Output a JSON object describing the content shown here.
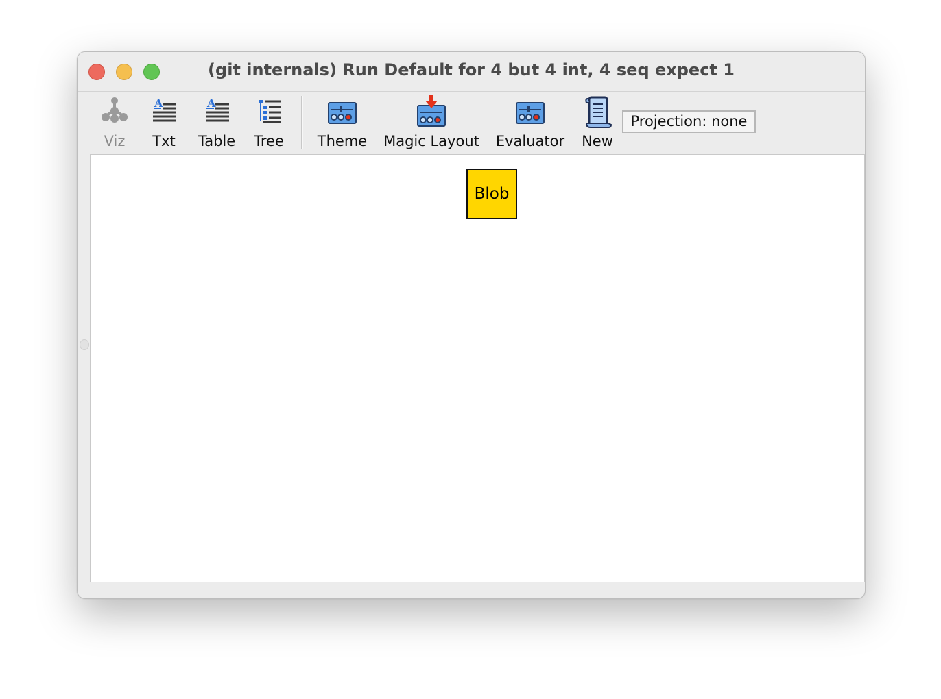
{
  "window": {
    "title": "(git internals) Run Default for 4 but 4 int, 4 seq expect 1"
  },
  "toolbar": {
    "buttons": [
      {
        "label": "Viz",
        "icon": "graph-tree-icon",
        "enabled": false
      },
      {
        "label": "Txt",
        "icon": "text-lines-icon",
        "enabled": true
      },
      {
        "label": "Table",
        "icon": "table-lines-icon",
        "enabled": true
      },
      {
        "label": "Tree",
        "icon": "tree-list-icon",
        "enabled": true
      },
      {
        "label": "Theme",
        "icon": "theme-settings-icon",
        "enabled": true
      },
      {
        "label": "Magic Layout",
        "icon": "magic-layout-icon",
        "enabled": true
      },
      {
        "label": "Evaluator",
        "icon": "evaluator-icon",
        "enabled": true
      },
      {
        "label": "New",
        "icon": "scroll-new-icon",
        "enabled": true
      }
    ],
    "projection": "Projection: none"
  },
  "graph": {
    "nodes": [
      {
        "label": "Blob",
        "color": "#ffd600"
      }
    ]
  },
  "colors": {
    "node_fill": "#ffd600",
    "accent_red": "#e3321b",
    "icon_blue": "#3b7fd4"
  }
}
